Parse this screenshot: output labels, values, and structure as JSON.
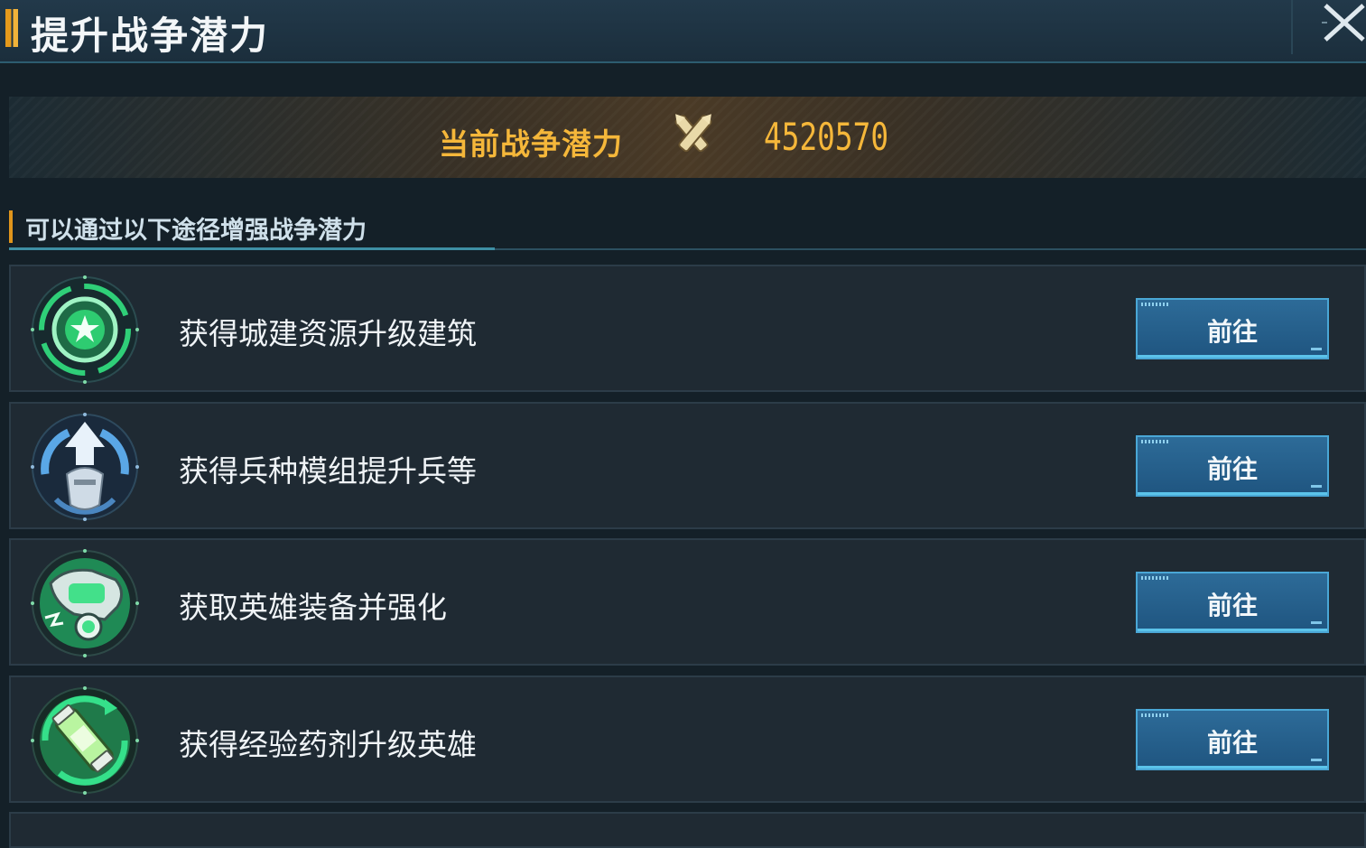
{
  "header": {
    "title": "提升战争潜力"
  },
  "power": {
    "label": "当前战争潜力",
    "value": "4520570"
  },
  "section": {
    "title": "可以通过以下途径增强战争潜力"
  },
  "ways": [
    {
      "label": "获得城建资源升级建筑",
      "button": "前往",
      "icon": "star-gear-icon"
    },
    {
      "label": "获得兵种模组提升兵等",
      "button": "前往",
      "icon": "soldier-upgrade-icon"
    },
    {
      "label": "获取英雄装备并强化",
      "button": "前往",
      "icon": "hero-equipment-icon"
    },
    {
      "label": "获得经验药剂升级英雄",
      "button": "前往",
      "icon": "exp-potion-icon"
    }
  ],
  "colors": {
    "accent_gold": "#f5b73a",
    "button_blue": "#2d6b98",
    "icon_green": "#2ecc71"
  }
}
